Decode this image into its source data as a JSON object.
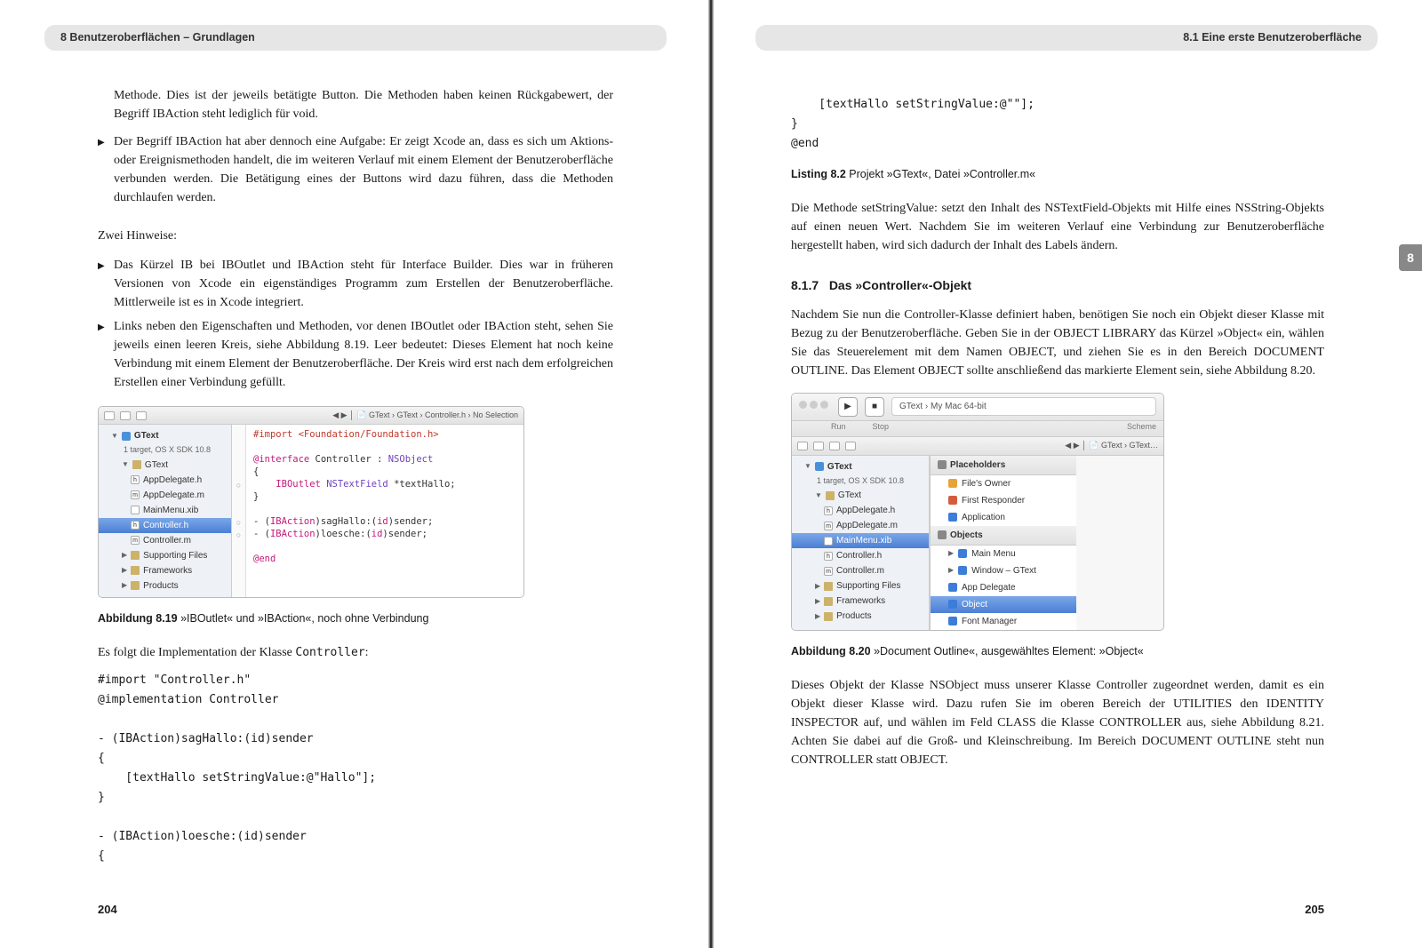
{
  "header": {
    "left": "8     Benutzeroberflächen – Grundlagen",
    "right": "8.1   Eine erste Benutzeroberfläche"
  },
  "thumb_tab": "8",
  "left_page": {
    "intro": "Methode. Dies ist der jeweils betätigte Button. Die Methoden haben keinen Rückgabewert, der Begriff IBAction steht lediglich für void.",
    "bullet1": "Der Begriff IBAction hat aber dennoch eine Aufgabe: Er zeigt Xcode an, dass es sich um Aktions- oder Ereignismethoden handelt, die im weiteren Verlauf mit einem Element der Benutzeroberfläche verbunden werden. Die Betätigung eines der Buttons wird dazu führen, dass die Methoden durchlaufen werden.",
    "hints_label": "Zwei Hinweise:",
    "bullet2": "Das Kürzel IB bei IBOutlet und IBAction steht für Interface Builder. Dies war in früheren Versionen von Xcode ein eigenständiges Programm zum Erstellen der Benutzeroberfläche. Mittlerweile ist es in Xcode integriert.",
    "bullet3": "Links neben den Eigenschaften und Methoden, vor denen IBOutlet oder IBAction steht, sehen Sie jeweils einen leeren Kreis, siehe Abbildung 8.19. Leer bedeutet: Dieses Element hat noch keine Verbindung mit einem Element der Benutzeroberfläche. Der Kreis wird erst nach dem erfolgreichen Erstellen einer Verbindung gefüllt.",
    "fig819": {
      "breadcrumb": "GText › GText › Controller.h › No Selection",
      "tree": {
        "root": "GText",
        "root_sub": "1 target, OS X SDK 10.8",
        "group": "GText",
        "files": [
          "AppDelegate.h",
          "AppDelegate.m",
          "MainMenu.xib",
          "Controller.h",
          "Controller.m",
          "Supporting Files",
          "Frameworks",
          "Products"
        ],
        "selected_index": 3
      },
      "code_lines": [
        "#import <Foundation/Foundation.h>",
        "",
        "@interface Controller : NSObject",
        "{",
        "    IBOutlet NSTextField *textHallo;",
        "}",
        "",
        "- (IBAction)sagHallo:(id)sender;",
        "- (IBAction)loesche:(id)sender;",
        "",
        "@end"
      ],
      "caption_label": "Abbildung 8.19",
      "caption_text": "  »IBOutlet« und »IBAction«, noch ohne Verbindung"
    },
    "impl_intro_a": "Es folgt die Implementation der Klasse ",
    "impl_intro_code": "Controller",
    "impl_intro_b": ":",
    "code_block": "#import \"Controller.h\"\n@implementation Controller\n\n- (IBAction)sagHallo:(id)sender\n{\n    [textHallo setStringValue:@\"Hallo\"];\n}\n\n- (IBAction)loesche:(id)sender\n{",
    "page_number": "204"
  },
  "right_page": {
    "code_tail": "    [textHallo setStringValue:@\"\"];\n}\n@end",
    "listing_label": "Listing 8.2",
    "listing_text": "  Projekt »GText«, Datei »Controller.m«",
    "p1": "Die Methode setStringValue: setzt den Inhalt des NSTextField-Objekts mit Hilfe eines NSString-Objekts auf einen neuen Wert. Nachdem Sie im weiteren Verlauf eine Verbindung zur Benutzeroberfläche hergestellt haben, wird sich dadurch der Inhalt des Labels ändern.",
    "section_num": "8.1.7",
    "section_title": "Das »Controller«-Objekt",
    "p2": "Nachdem Sie nun die Controller-Klasse definiert haben, benötigen Sie noch ein Objekt dieser Klasse mit Bezug zu der Benutzeroberfläche. Geben Sie in der OBJECT LIBRARY das Kürzel »Object« ein, wählen Sie das Steuerelement mit dem Namen OBJECT, und ziehen Sie es in den Bereich DOCUMENT OUTLINE. Das Element OBJECT sollte anschließend das markierte Element sein, siehe Abbildung 8.20.",
    "fig820": {
      "scheme": "GText › My Mac 64-bit",
      "run": "Run",
      "stop": "Stop",
      "scheme_lbl": "Scheme",
      "breadcrumb": "GText › GText…",
      "tree": {
        "root": "GText",
        "root_sub": "1 target, OS X SDK 10.8",
        "group": "GText",
        "files": [
          "AppDelegate.h",
          "AppDelegate.m",
          "MainMenu.xib",
          "Controller.h",
          "Controller.m",
          "Supporting Files",
          "Frameworks",
          "Products"
        ],
        "selected_index": 2
      },
      "placeholders_label": "Placeholders",
      "placeholders": [
        "File's Owner",
        "First Responder",
        "Application"
      ],
      "objects_label": "Objects",
      "objects": [
        "Main Menu",
        "Window – GText",
        "App Delegate",
        "Object",
        "Font Manager"
      ],
      "objects_selected_index": 3,
      "caption_label": "Abbildung 8.20",
      "caption_text": "  »Document Outline«, ausgewähltes Element: »Object«"
    },
    "p3": "Dieses Objekt der Klasse NSObject muss unserer Klasse Controller zugeordnet werden, damit es ein Objekt dieser Klasse wird. Dazu rufen Sie im oberen Bereich der UTILITIES den IDENTITY INSPECTOR auf, und wählen im Feld CLASS die Klasse CONTROLLER aus, siehe Abbildung 8.21. Achten Sie dabei auf die Groß- und Kleinschreibung. Im Bereich DOCUMENT OUTLINE steht nun CONTROLLER statt OBJECT.",
    "page_number": "205"
  }
}
